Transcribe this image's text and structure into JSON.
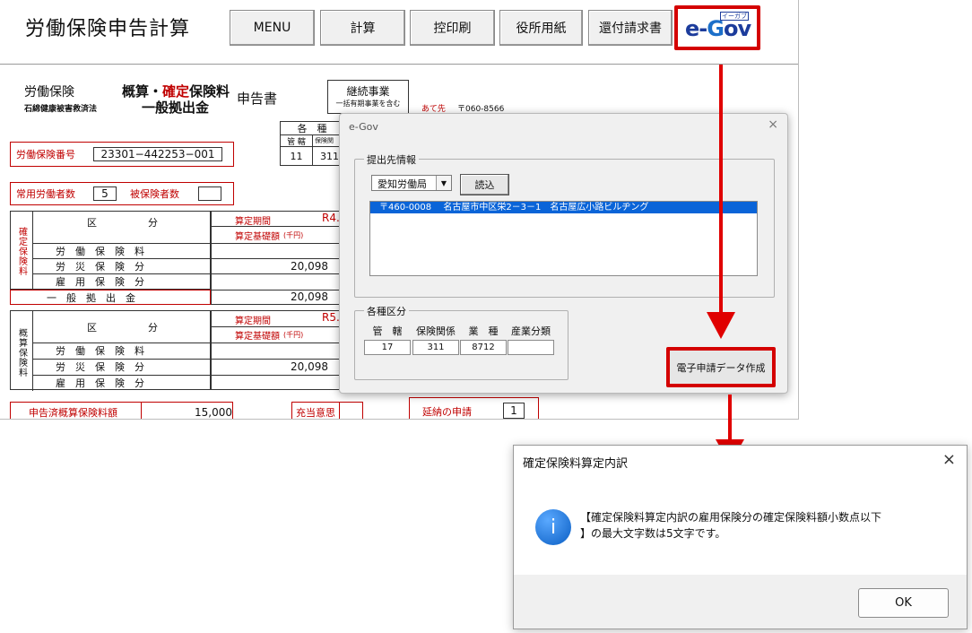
{
  "app": {
    "title": "労働保険申告計算",
    "toolbar": [
      "MENU",
      "計算",
      "控印刷",
      "役所用紙",
      "還付請求書"
    ],
    "egov": {
      "logo_e": "e-",
      "logo_g": "G",
      "logo_ov": "ov",
      "kana": "イーガブ"
    }
  },
  "form": {
    "left_heading_1": "労働保険",
    "left_heading_2": "石綿健康被害救済法",
    "mid_heading_1a": "概算・",
    "mid_heading_1b": "確定",
    "mid_heading_1c": "保険料",
    "mid_heading_2": "一般拠出金",
    "report": "申告書",
    "continuing_1": "継続事業",
    "continuing_2": "一括有期事業を含む",
    "dest_label": "あて先",
    "dest_postal": "〒060-8566",
    "kakushu": "各　種",
    "kankatsu": "管 轄",
    "hoken_small": "保険関",
    "kankatsu_val": "11",
    "hoken_val": "311",
    "labor_no_label": "労働保険番号",
    "labor_no": "23301−442253−001",
    "workers_label": "常用労働者数",
    "workers": "5",
    "insured_label": "被保険者数",
    "insured": "",
    "kubun": "区",
    "bun": "分",
    "kakutei_vertical": "確定保険料",
    "gaisan_vertical": "概算保険料",
    "rows": [
      "労　働　保　険　料",
      "労　災　保　険　分",
      "雇　用　保　険　分"
    ],
    "ippan": "一　般　拠　出　金",
    "santei_period": "算定期間",
    "santei_period_val1": "R4.",
    "santei_period_val2": "R5.",
    "santei_base": "算定基礎額",
    "santei_unit": "(千円)",
    "amount_20098": "20,098",
    "declared_label": "申告済概算保険料額",
    "declared_val": "15,000",
    "juto_label": "充当意思",
    "delay_label": "延納の申請",
    "delay_val": "1"
  },
  "egov_dialog": {
    "title": "e-Gov",
    "close": "×",
    "group1": "提出先情報",
    "select_value": "愛知労働局",
    "read_button": "読込",
    "list_item": "〒460-0008　 名古屋市中区栄2－3－1　名古屋広小路ビルヂング",
    "group2": "各種区分",
    "col_headers": [
      "管　轄",
      "保険関係",
      "業　種",
      "産業分類"
    ],
    "col_values": [
      "17",
      "311",
      "8712",
      ""
    ],
    "create_button": "電子申請データ作成"
  },
  "message_box": {
    "title": "確定保険料算定内訳",
    "close": "×",
    "icon": "i",
    "line1": "【確定保険料算定内訳の雇用保険分の確定保険料額小数点以下",
    "line2": "】の最大文字数は5文字です。",
    "ok": "OK"
  },
  "colors": {
    "highlight_red": "#d40000",
    "form_red": "#c00000",
    "selection_blue": "#0a64d8",
    "egov_blue": "#1c3c9c"
  }
}
